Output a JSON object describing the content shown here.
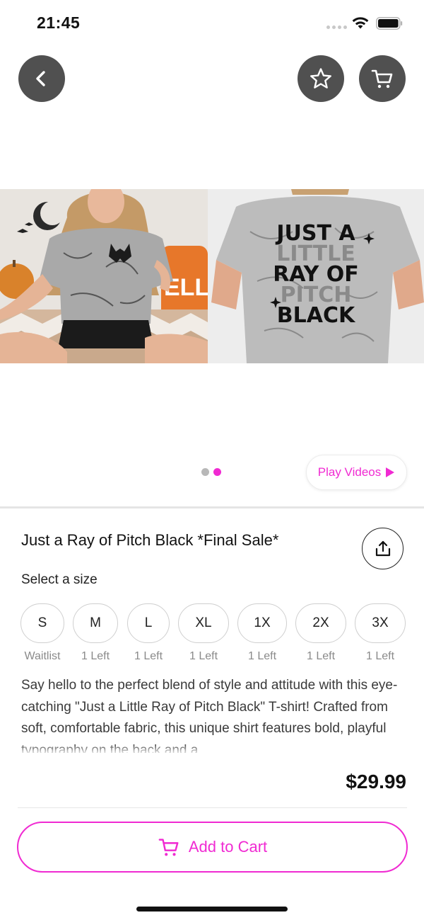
{
  "status_bar": {
    "time": "21:45"
  },
  "gallery": {
    "front_image": "woman wearing gray marble tee with bat graphic",
    "back_image": "gray marble tee back print",
    "back_print_lines": [
      "JUST A",
      "LITTLE",
      "RAY OF",
      "PITCH",
      "BLACK"
    ],
    "dots": [
      {
        "active": false
      },
      {
        "active": true
      }
    ]
  },
  "play_videos": {
    "label": "Play Videos"
  },
  "product": {
    "title": "Just a Ray of Pitch Black *Final Sale*",
    "size_heading": "Select a size",
    "sizes": [
      {
        "label": "S",
        "stock": "Waitlist"
      },
      {
        "label": "M",
        "stock": "1 Left"
      },
      {
        "label": "L",
        "stock": "1 Left"
      },
      {
        "label": "XL",
        "stock": "1 Left"
      },
      {
        "label": "1X",
        "stock": "1 Left"
      },
      {
        "label": "2X",
        "stock": "1 Left"
      },
      {
        "label": "3X",
        "stock": "1 Left"
      }
    ],
    "description": "Say hello to the perfect blend of style and attitude with this eye-catching \"Just a Little Ray of Pitch Black\" T-shirt! Crafted from soft, comfortable fabric, this unique shirt features bold, playful typography on the back and a"
  },
  "footer": {
    "price": "$29.99",
    "add_to_cart_label": "Add to Cart"
  },
  "colors": {
    "accent": "#f02ad2",
    "nav_button_bg": "#505050",
    "text": "#121212",
    "muted": "#8a8a8a"
  },
  "icons": {
    "back": "chevron-left-icon",
    "favorite": "star-icon",
    "cart": "cart-icon",
    "share": "share-icon",
    "play": "play-icon"
  }
}
